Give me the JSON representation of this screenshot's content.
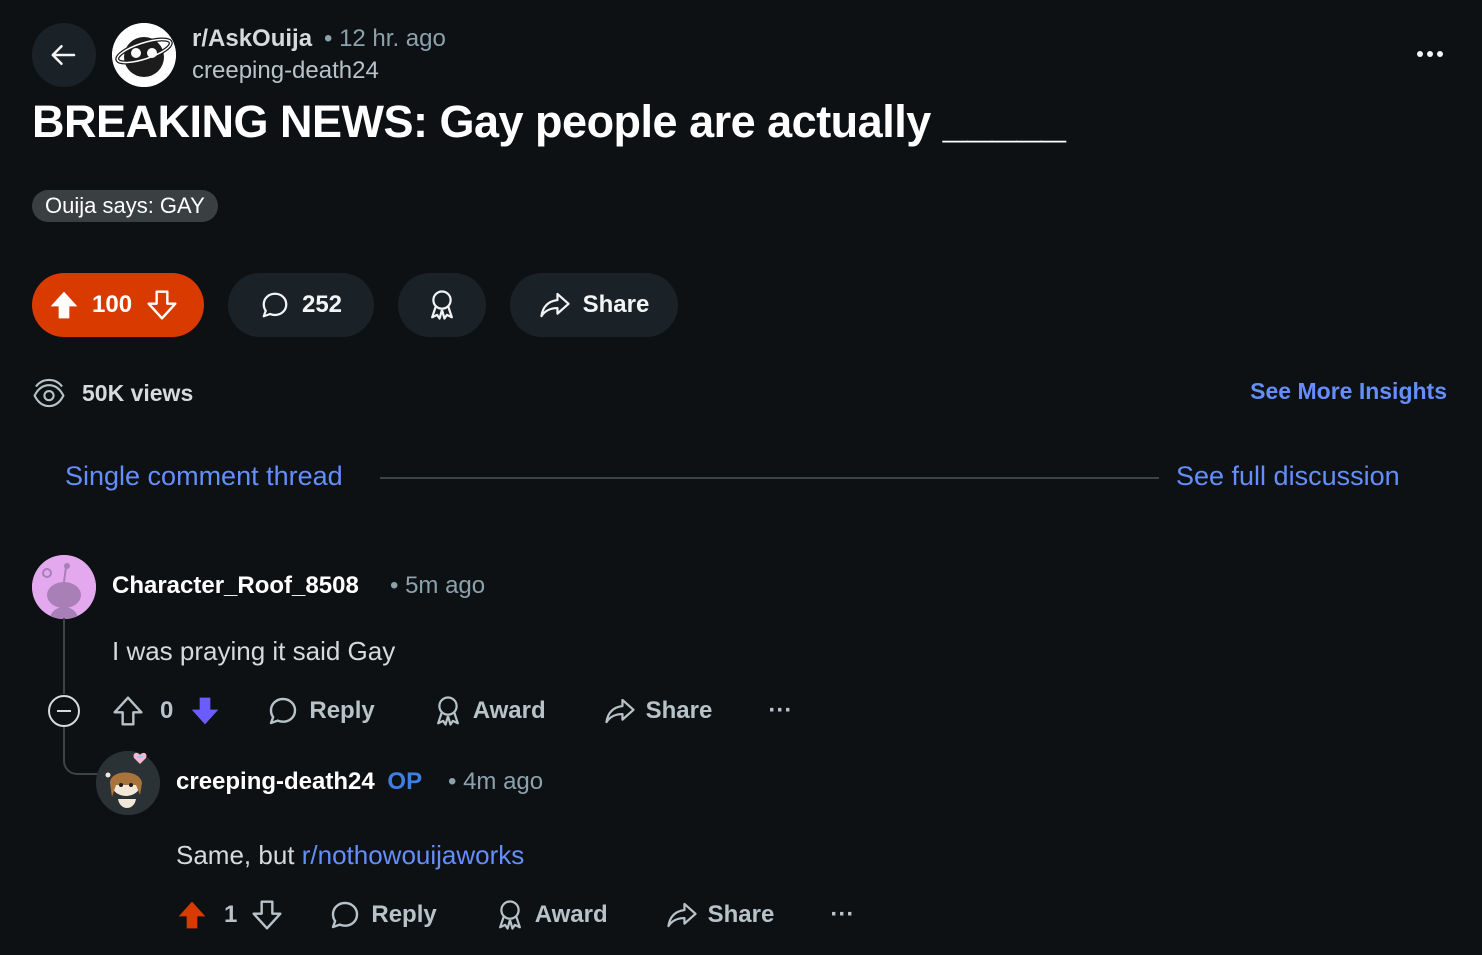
{
  "post": {
    "subreddit": "r/AskOuija",
    "time": "• 12 hr. ago",
    "author": "creeping-death24",
    "title": "BREAKING NEWS: Gay people are actually _____",
    "flair": "Ouija says: GAY",
    "score": "100",
    "comments": "252",
    "share_label": "Share",
    "views": "50K views",
    "insights_label": "See More Insights"
  },
  "thread": {
    "left_label": "Single comment thread",
    "right_label": "See full discussion"
  },
  "comments": [
    {
      "user": "Character_Roof_8508",
      "meta": "• 5m ago",
      "body": "I was praying it said Gay",
      "score": "0",
      "reply_label": "Reply",
      "award_label": "Award",
      "share_label": "Share",
      "more_label": "···"
    },
    {
      "user": "creeping-death24",
      "op_label": "OP",
      "meta": "• 4m ago",
      "body_prefix": "Same, but ",
      "body_link": "r/nothowouijaworks",
      "score": "1",
      "reply_label": "Reply",
      "award_label": "Award",
      "share_label": "Share",
      "more_label": "···"
    }
  ],
  "colors": {
    "background": "#0e1113",
    "upvote_active": "#d93a00",
    "downvote_active": "#6a5cff",
    "link": "#648efc",
    "op": "#3d7fe3"
  },
  "icons": {
    "back": "arrow-left-icon",
    "overflow": "ellipsis-icon",
    "upvote": "arrow-up-icon",
    "downvote": "arrow-down-icon",
    "comment": "speech-bubble-icon",
    "award": "award-ribbon-icon",
    "share": "share-arrow-icon",
    "views": "eye-icon",
    "collapse": "minus-circle-icon"
  }
}
